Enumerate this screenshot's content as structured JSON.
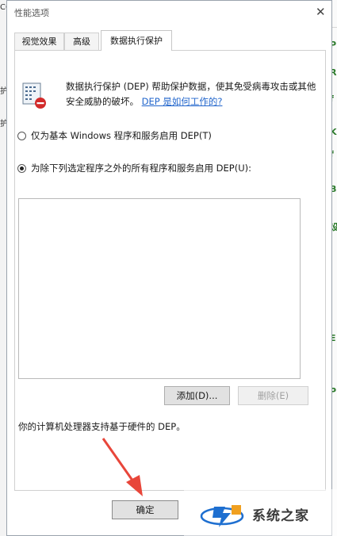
{
  "background": {
    "left_fragments": [
      "CC",
      "护",
      "护"
    ],
    "right_fragments": [
      "P",
      "R",
      "f",
      "K",
      "f",
      "B",
      "设",
      "i",
      "l",
      "i",
      "E",
      "P"
    ]
  },
  "dialog": {
    "title": "性能选项",
    "close_glyph": "✕",
    "tabs": [
      {
        "label": "视觉效果",
        "active": false
      },
      {
        "label": "高级",
        "active": false
      },
      {
        "label": "数据执行保护",
        "active": true
      }
    ],
    "description": "数据执行保护 (DEP) 帮助保护数据，使其免受病毒攻击或其他安全威胁的破坏。",
    "description_link": "DEP 是如何工作的?",
    "options": [
      {
        "label": "仅为基本 Windows 程序和服务启用 DEP(T)",
        "selected": false
      },
      {
        "label": "为除下列选定程序之外的所有程序和服务启用 DEP(U):",
        "selected": true
      }
    ],
    "add_button": "添加(D)...",
    "remove_button": "删除(E)",
    "hardware_note": "你的计算机处理器支持基于硬件的 DEP。",
    "ok_button": "确定"
  },
  "watermark": {
    "text": "系统之家"
  },
  "colors": {
    "link": "#2266cc",
    "arrow": "#e8463a",
    "accent": "#1e6fd0"
  }
}
